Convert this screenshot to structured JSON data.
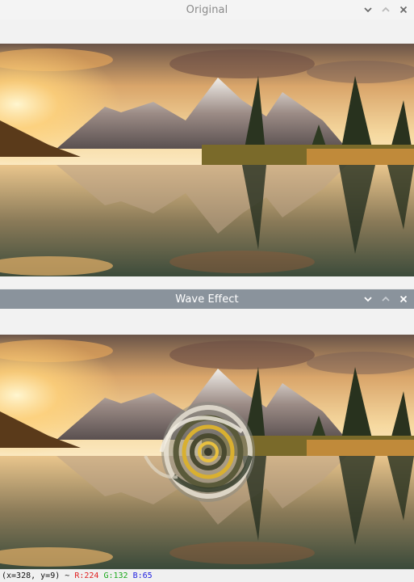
{
  "windows": {
    "original": {
      "title": "Original"
    },
    "wave": {
      "title": "Wave Effect"
    }
  },
  "icons": {
    "minimize": "chevron-down-icon",
    "maximize": "chevron-up-icon",
    "close": "close-icon"
  },
  "status": {
    "coords": "(x=328, y=9) ~",
    "r": "R:224",
    "g": "G:132",
    "b": "B:65"
  },
  "colors": {
    "red": "#e02020",
    "green": "#18a818",
    "blue": "#2020e0",
    "active_titlebar": "#8a939c"
  }
}
